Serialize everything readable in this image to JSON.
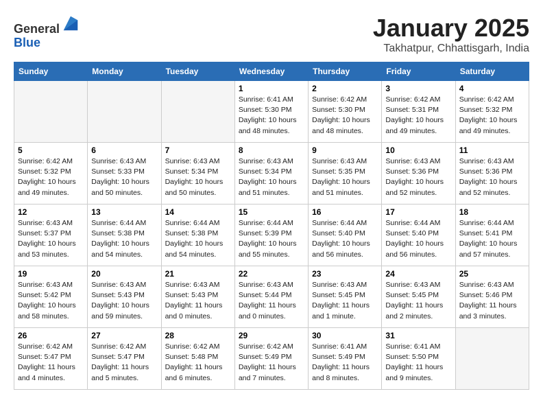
{
  "header": {
    "logo_line1": "General",
    "logo_line2": "Blue",
    "month_title": "January 2025",
    "subtitle": "Takhatpur, Chhattisgarh, India"
  },
  "weekdays": [
    "Sunday",
    "Monday",
    "Tuesday",
    "Wednesday",
    "Thursday",
    "Friday",
    "Saturday"
  ],
  "weeks": [
    [
      {
        "day": "",
        "info": ""
      },
      {
        "day": "",
        "info": ""
      },
      {
        "day": "",
        "info": ""
      },
      {
        "day": "1",
        "info": "Sunrise: 6:41 AM\nSunset: 5:30 PM\nDaylight: 10 hours\nand 48 minutes."
      },
      {
        "day": "2",
        "info": "Sunrise: 6:42 AM\nSunset: 5:30 PM\nDaylight: 10 hours\nand 48 minutes."
      },
      {
        "day": "3",
        "info": "Sunrise: 6:42 AM\nSunset: 5:31 PM\nDaylight: 10 hours\nand 49 minutes."
      },
      {
        "day": "4",
        "info": "Sunrise: 6:42 AM\nSunset: 5:32 PM\nDaylight: 10 hours\nand 49 minutes."
      }
    ],
    [
      {
        "day": "5",
        "info": "Sunrise: 6:42 AM\nSunset: 5:32 PM\nDaylight: 10 hours\nand 49 minutes."
      },
      {
        "day": "6",
        "info": "Sunrise: 6:43 AM\nSunset: 5:33 PM\nDaylight: 10 hours\nand 50 minutes."
      },
      {
        "day": "7",
        "info": "Sunrise: 6:43 AM\nSunset: 5:34 PM\nDaylight: 10 hours\nand 50 minutes."
      },
      {
        "day": "8",
        "info": "Sunrise: 6:43 AM\nSunset: 5:34 PM\nDaylight: 10 hours\nand 51 minutes."
      },
      {
        "day": "9",
        "info": "Sunrise: 6:43 AM\nSunset: 5:35 PM\nDaylight: 10 hours\nand 51 minutes."
      },
      {
        "day": "10",
        "info": "Sunrise: 6:43 AM\nSunset: 5:36 PM\nDaylight: 10 hours\nand 52 minutes."
      },
      {
        "day": "11",
        "info": "Sunrise: 6:43 AM\nSunset: 5:36 PM\nDaylight: 10 hours\nand 52 minutes."
      }
    ],
    [
      {
        "day": "12",
        "info": "Sunrise: 6:43 AM\nSunset: 5:37 PM\nDaylight: 10 hours\nand 53 minutes."
      },
      {
        "day": "13",
        "info": "Sunrise: 6:44 AM\nSunset: 5:38 PM\nDaylight: 10 hours\nand 54 minutes."
      },
      {
        "day": "14",
        "info": "Sunrise: 6:44 AM\nSunset: 5:38 PM\nDaylight: 10 hours\nand 54 minutes."
      },
      {
        "day": "15",
        "info": "Sunrise: 6:44 AM\nSunset: 5:39 PM\nDaylight: 10 hours\nand 55 minutes."
      },
      {
        "day": "16",
        "info": "Sunrise: 6:44 AM\nSunset: 5:40 PM\nDaylight: 10 hours\nand 56 minutes."
      },
      {
        "day": "17",
        "info": "Sunrise: 6:44 AM\nSunset: 5:40 PM\nDaylight: 10 hours\nand 56 minutes."
      },
      {
        "day": "18",
        "info": "Sunrise: 6:44 AM\nSunset: 5:41 PM\nDaylight: 10 hours\nand 57 minutes."
      }
    ],
    [
      {
        "day": "19",
        "info": "Sunrise: 6:43 AM\nSunset: 5:42 PM\nDaylight: 10 hours\nand 58 minutes."
      },
      {
        "day": "20",
        "info": "Sunrise: 6:43 AM\nSunset: 5:43 PM\nDaylight: 10 hours\nand 59 minutes."
      },
      {
        "day": "21",
        "info": "Sunrise: 6:43 AM\nSunset: 5:43 PM\nDaylight: 11 hours\nand 0 minutes."
      },
      {
        "day": "22",
        "info": "Sunrise: 6:43 AM\nSunset: 5:44 PM\nDaylight: 11 hours\nand 0 minutes."
      },
      {
        "day": "23",
        "info": "Sunrise: 6:43 AM\nSunset: 5:45 PM\nDaylight: 11 hours\nand 1 minute."
      },
      {
        "day": "24",
        "info": "Sunrise: 6:43 AM\nSunset: 5:45 PM\nDaylight: 11 hours\nand 2 minutes."
      },
      {
        "day": "25",
        "info": "Sunrise: 6:43 AM\nSunset: 5:46 PM\nDaylight: 11 hours\nand 3 minutes."
      }
    ],
    [
      {
        "day": "26",
        "info": "Sunrise: 6:42 AM\nSunset: 5:47 PM\nDaylight: 11 hours\nand 4 minutes."
      },
      {
        "day": "27",
        "info": "Sunrise: 6:42 AM\nSunset: 5:47 PM\nDaylight: 11 hours\nand 5 minutes."
      },
      {
        "day": "28",
        "info": "Sunrise: 6:42 AM\nSunset: 5:48 PM\nDaylight: 11 hours\nand 6 minutes."
      },
      {
        "day": "29",
        "info": "Sunrise: 6:42 AM\nSunset: 5:49 PM\nDaylight: 11 hours\nand 7 minutes."
      },
      {
        "day": "30",
        "info": "Sunrise: 6:41 AM\nSunset: 5:49 PM\nDaylight: 11 hours\nand 8 minutes."
      },
      {
        "day": "31",
        "info": "Sunrise: 6:41 AM\nSunset: 5:50 PM\nDaylight: 11 hours\nand 9 minutes."
      },
      {
        "day": "",
        "info": ""
      }
    ]
  ]
}
